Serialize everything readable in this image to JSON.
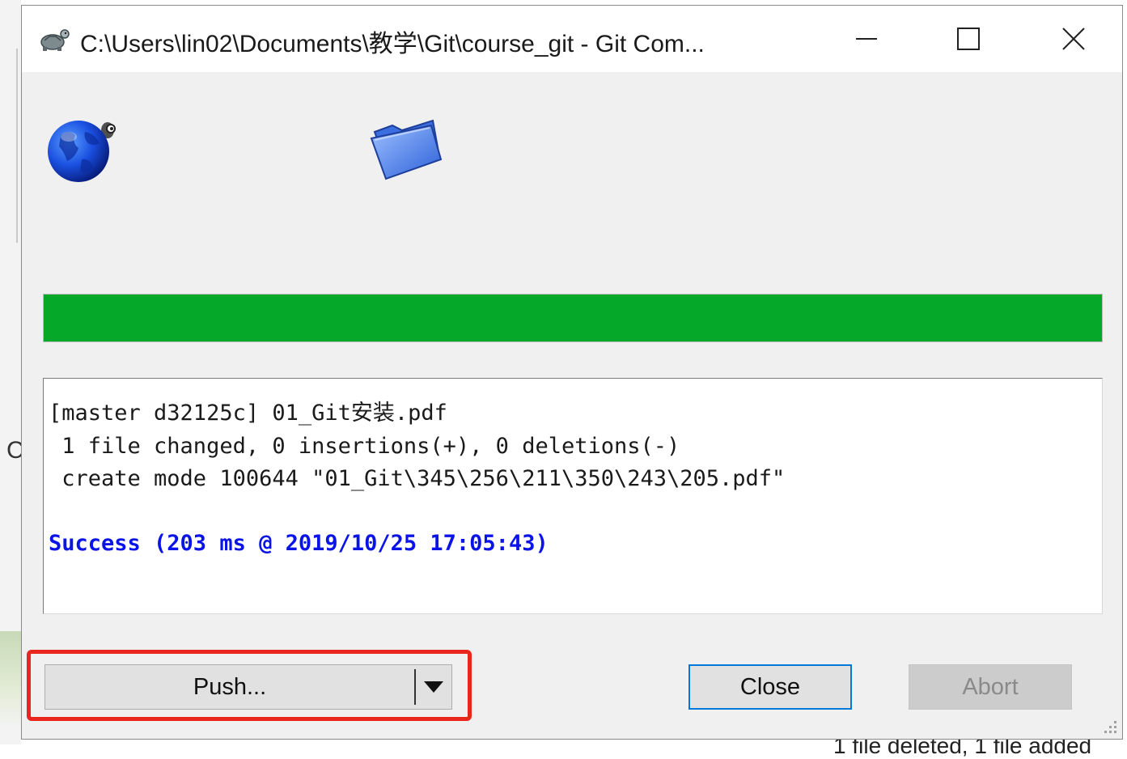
{
  "window": {
    "title": "C:\\Users\\lin02\\Documents\\教学\\Git\\course_git - Git Com...",
    "controls": {
      "minimize": "minimize",
      "maximize": "maximize",
      "close": "close"
    }
  },
  "icons": {
    "app": "tortoisegit-icon",
    "globe": "globe-icon",
    "folder": "folder-icon"
  },
  "progress": {
    "fraction": 1.0,
    "color": "#06a829"
  },
  "log": {
    "lines": [
      "[master d32125c] 01_Git安装.pdf",
      " 1 file changed, 0 insertions(+), 0 deletions(-)",
      " create mode 100644 \"01_Git\\345\\256\\211\\350\\243\\205.pdf\""
    ],
    "status": "Success (203 ms @ 2019/10/25 17:05:43)",
    "status_color": "#0a14e6"
  },
  "buttons": {
    "push": "Push...",
    "close": "Close",
    "abort": "Abort"
  },
  "highlight_color": "#e8261e",
  "background": {
    "left_char": "C",
    "bottom_text": "1 file deleted, 1 file added"
  }
}
